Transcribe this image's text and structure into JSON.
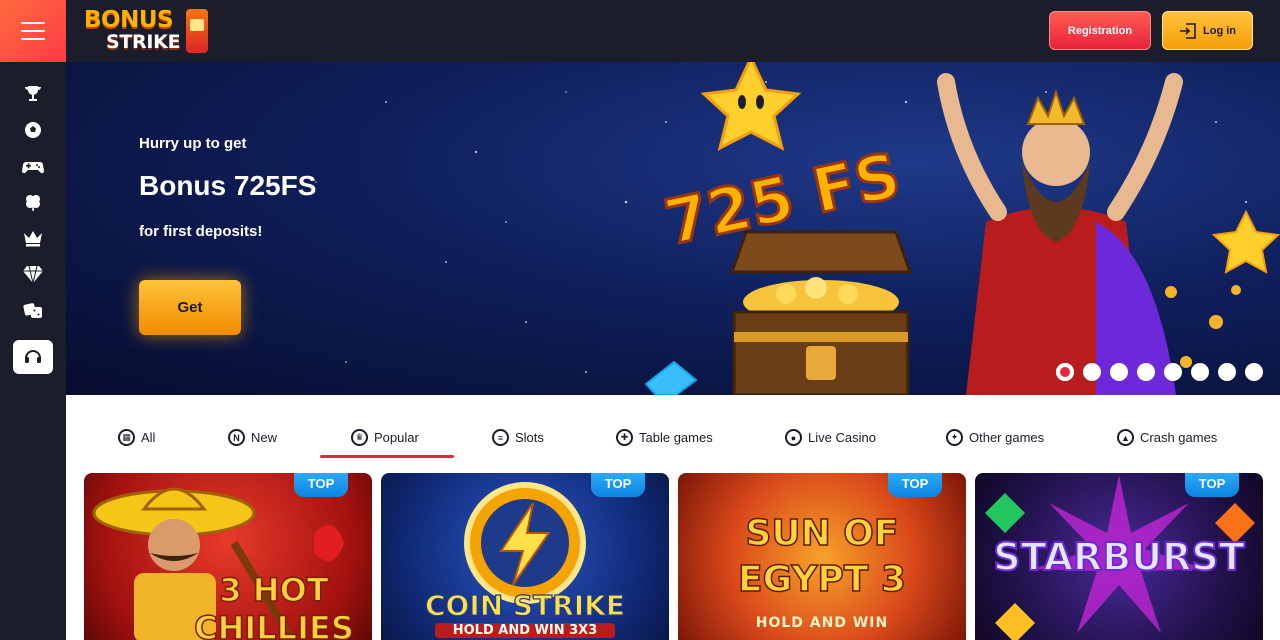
{
  "header": {
    "logo_line1": "BONUS",
    "logo_line2": "STRIKE",
    "registration_label": "Registration",
    "login_label": "Log in"
  },
  "sidebar": {
    "icons": [
      "trophy-icon",
      "soccer-ball-icon",
      "gamepad-icon",
      "clover-icon",
      "crown-icon",
      "diamond-icon",
      "dice-icon",
      "headset-icon"
    ]
  },
  "banner": {
    "hurry": "Hurry up to get",
    "title": "Bonus 725FS",
    "subtitle": "for first deposits!",
    "cta": "Get",
    "art_text": "725 FS",
    "slide_count": 8,
    "active_slide": 1
  },
  "tabs": [
    {
      "label": "All",
      "icon": "grid-icon"
    },
    {
      "label": "New",
      "icon": "new-icon"
    },
    {
      "label": "Popular",
      "icon": "popular-icon",
      "active": true
    },
    {
      "label": "Slots",
      "icon": "slots-icon"
    },
    {
      "label": "Table games",
      "icon": "chip-icon"
    },
    {
      "label": "Live Casino",
      "icon": "live-icon"
    },
    {
      "label": "Other games",
      "icon": "other-games-icon"
    },
    {
      "label": "Crash games",
      "icon": "crash-games-icon"
    }
  ],
  "games": [
    {
      "badge": "TOP",
      "title": "3 HOT CHILLIES",
      "subtitle": ""
    },
    {
      "badge": "TOP",
      "title": "COIN STRIKE",
      "subtitle": "HOLD AND WIN 3X3"
    },
    {
      "badge": "TOP",
      "title": "SUN OF EGYPT 3",
      "subtitle": "HOLD AND WIN"
    },
    {
      "badge": "TOP",
      "title": "STARBURST",
      "subtitle": ""
    }
  ],
  "colors": {
    "accent_red": "#e8233a",
    "accent_gold": "#f59e0b",
    "dark": "#1b1d2b",
    "badge_blue": "#0a84e0"
  }
}
